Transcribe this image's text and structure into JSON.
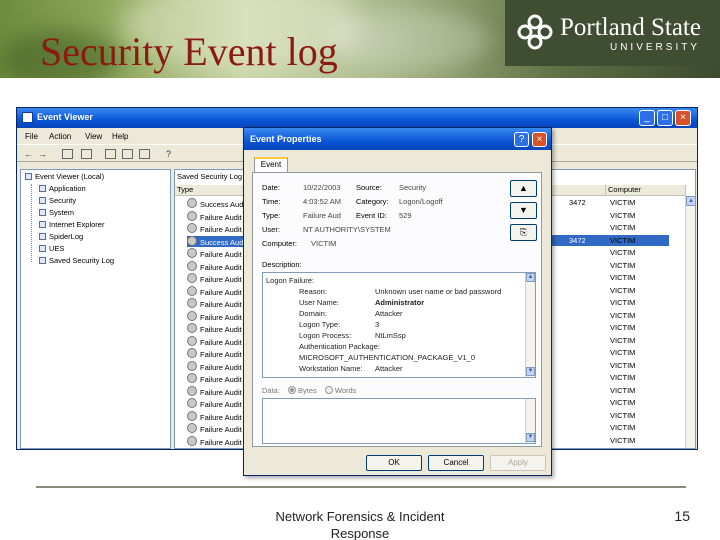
{
  "slide": {
    "title": "Security Event log",
    "logo": {
      "name": "Portland State",
      "sub": "UNIVERSITY"
    },
    "footer": "Network Forensics & Incident Response",
    "page_number": "15"
  },
  "event_viewer": {
    "title": "Event Viewer",
    "menu": [
      "File",
      "Action",
      "View",
      "Help"
    ],
    "tree_root": "Event Viewer (Local)",
    "tree_items": [
      "Application",
      "Security",
      "System",
      "Internet Explorer",
      "SpiderLog",
      "UES",
      "Saved Security Log"
    ],
    "list_title": "Saved Security Log",
    "columns": {
      "type": "Type",
      "computer": "Computer"
    },
    "rows": [
      {
        "type": "Success Audit",
        "num": "3472",
        "computer": "VICTIM"
      },
      {
        "type": "Failure Audit",
        "num": "",
        "computer": "VICTIM"
      },
      {
        "type": "Failure Audit",
        "num": "",
        "computer": "VICTIM"
      },
      {
        "type": "Success Audit",
        "num": "3472",
        "computer": "VICTIM",
        "selected": true
      },
      {
        "type": "Failure Audit",
        "num": "",
        "computer": "VICTIM"
      },
      {
        "type": "Failure Audit",
        "num": "",
        "computer": "VICTIM"
      },
      {
        "type": "Failure Audit",
        "num": "",
        "computer": "VICTIM"
      },
      {
        "type": "Failure Audit",
        "num": "",
        "computer": "VICTIM"
      },
      {
        "type": "Failure Audit",
        "num": "",
        "computer": "VICTIM"
      },
      {
        "type": "Failure Audit",
        "num": "",
        "computer": "VICTIM"
      },
      {
        "type": "Failure Audit",
        "num": "",
        "computer": "VICTIM"
      },
      {
        "type": "Failure Audit",
        "num": "",
        "computer": "VICTIM"
      },
      {
        "type": "Failure Audit",
        "num": "",
        "computer": "VICTIM"
      },
      {
        "type": "Failure Audit",
        "num": "",
        "computer": "VICTIM"
      },
      {
        "type": "Failure Audit",
        "num": "",
        "computer": "VICTIM"
      },
      {
        "type": "Failure Audit",
        "num": "",
        "computer": "VICTIM"
      },
      {
        "type": "Failure Audit",
        "num": "",
        "computer": "VICTIM"
      },
      {
        "type": "Failure Audit",
        "num": "",
        "computer": "VICTIM"
      },
      {
        "type": "Failure Audit",
        "num": "",
        "computer": "VICTIM"
      },
      {
        "type": "Failure Audit",
        "num": "",
        "computer": "VICTIM"
      }
    ]
  },
  "event_properties": {
    "title": "Event Properties",
    "tab": "Event",
    "date_label": "Date:",
    "date": "10/22/2003",
    "source_label": "Source:",
    "source": "Security",
    "time_label": "Time:",
    "time": "4:03:52 AM",
    "category_label": "Category:",
    "category": "Logon/Logoff",
    "type_label": "Type:",
    "type": "Failure Aud",
    "event_id_label": "Event ID:",
    "event_id": "529",
    "user_label": "User:",
    "user": "NT AUTHORITY\\SYSTEM",
    "computer_label": "Computer:",
    "computer": "VICTIM",
    "description_label": "Description:",
    "description": [
      {
        "key": "Logon Failure:",
        "val": ""
      },
      {
        "key": "Reason:",
        "val": "Unknown user name or bad password"
      },
      {
        "key": "User Name:",
        "val": "Administrator"
      },
      {
        "key": "Domain:",
        "val": "Attacker"
      },
      {
        "key": "Logon Type:",
        "val": "3"
      },
      {
        "key": "Logon Process:",
        "val": "NtLmSsp"
      },
      {
        "key": "Authentication Package:",
        "val": ""
      },
      {
        "key": "MICROSOFT_AUTHENTICATION_PACKAGE_V1_0",
        "val": ""
      },
      {
        "key": "Workstation Name:",
        "val": "Attacker"
      }
    ],
    "data_label": "Data:",
    "bytes_label": "Bytes",
    "words_label": "Words",
    "buttons": {
      "ok": "OK",
      "cancel": "Cancel",
      "apply": "Apply"
    }
  }
}
